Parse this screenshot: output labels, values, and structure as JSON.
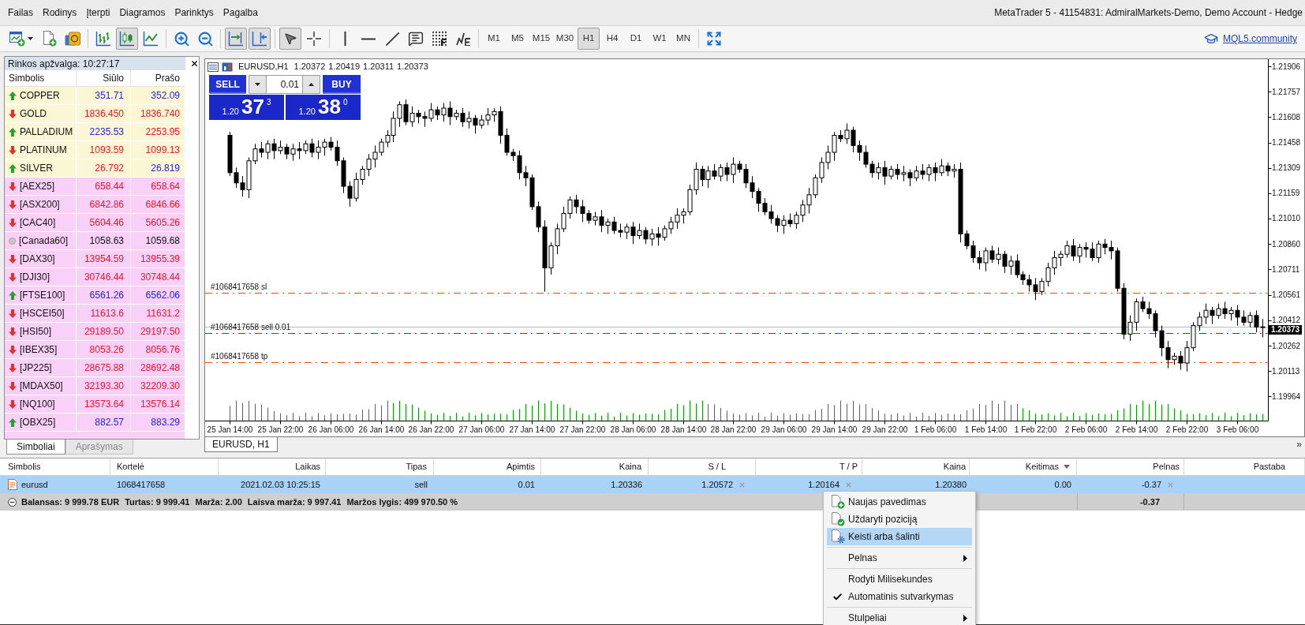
{
  "window": {
    "title": "MetaTrader 5 - 41154831: AdmiralMarkets-Demo, Demo Account - Hedge"
  },
  "menu": [
    "Failas",
    "Rodinys",
    "Įterpti",
    "Diagramos",
    "Parinktys",
    "Pagalba"
  ],
  "toolbar": {
    "tool_groups": [
      [
        {
          "pressed": false
        },
        {
          "pressed": false
        },
        {
          "pressed": false
        }
      ],
      [
        {
          "pressed": false
        },
        {
          "pressed": true
        },
        {
          "pressed": false
        }
      ],
      [
        {
          "pressed": false
        },
        {
          "pressed": false
        }
      ],
      [
        {
          "pressed": true
        },
        {
          "pressed": true
        }
      ],
      [
        {
          "pressed": true
        },
        {
          "pressed": false
        }
      ],
      [
        {
          "pressed": false
        },
        {
          "pressed": false
        },
        {
          "pressed": false
        },
        {
          "pressed": false
        },
        {
          "pressed": false
        },
        {
          "pressed": false
        }
      ]
    ],
    "timeframes": [
      {
        "label": "M1",
        "selected": false
      },
      {
        "label": "M5",
        "selected": false
      },
      {
        "label": "M15",
        "selected": false
      },
      {
        "label": "M30",
        "selected": false
      },
      {
        "label": "H1",
        "selected": true
      },
      {
        "label": "H4",
        "selected": false
      },
      {
        "label": "D1",
        "selected": false
      },
      {
        "label": "W1",
        "selected": false
      },
      {
        "label": "MN",
        "selected": false
      }
    ],
    "view_tools": [
      {
        "pressed": false
      }
    ],
    "community_link": "MQL5.community"
  },
  "market_watch": {
    "title": "Rinkos apžvalga: 10:27:17",
    "columns": [
      "Simbolis",
      "Siūlo",
      "Prašo"
    ],
    "rows": [
      {
        "symbol": "COPPER",
        "kind": "up",
        "bid": {
          "text": "351.71",
          "color": "#1f1fe0"
        },
        "ask": {
          "text": "352.09",
          "color": "#1f1fe0"
        },
        "color": "#fbf6d3"
      },
      {
        "symbol": "GOLD",
        "kind": "down",
        "bid": {
          "text": "1836.450",
          "color": "#f0142a"
        },
        "ask": {
          "text": "1836.740",
          "color": "#f0142a"
        },
        "color": "#fbf6d3"
      },
      {
        "symbol": "PALLADIUM",
        "kind": "up",
        "bid": {
          "text": "2235.53",
          "color": "#1f1fe0"
        },
        "ask": {
          "text": "2253.95",
          "color": "#f0142a"
        },
        "color": "#fbf6d3"
      },
      {
        "symbol": "PLATINUM",
        "kind": "down",
        "bid": {
          "text": "1093.59",
          "color": "#f0142a"
        },
        "ask": {
          "text": "1099.13",
          "color": "#f0142a"
        },
        "color": "#fbf6d3"
      },
      {
        "symbol": "SILVER",
        "kind": "up",
        "bid": {
          "text": "26.792",
          "color": "#f0142a"
        },
        "ask": {
          "text": "26.819",
          "color": "#1f1fe0"
        },
        "color": "#fbf6d3"
      },
      {
        "symbol": "[AEX25]",
        "kind": "down",
        "bid": {
          "text": "658.44",
          "color": "#f0142a"
        },
        "ask": {
          "text": "658.64",
          "color": "#f0142a"
        },
        "color": "#f8d0f8"
      },
      {
        "symbol": "[ASX200]",
        "kind": "down",
        "bid": {
          "text": "6842.86",
          "color": "#f0142a"
        },
        "ask": {
          "text": "6846.66",
          "color": "#f0142a"
        },
        "color": "#f8d0f8"
      },
      {
        "symbol": "[CAC40]",
        "kind": "down",
        "bid": {
          "text": "5604.46",
          "color": "#f0142a"
        },
        "ask": {
          "text": "5605.26",
          "color": "#f0142a"
        },
        "color": "#f8d0f8"
      },
      {
        "symbol": "[Canada60]",
        "kind": "flat",
        "bid": {
          "text": "1058.63",
          "color": "#111111"
        },
        "ask": {
          "text": "1059.68",
          "color": "#111111"
        },
        "color": "#f8d0f8"
      },
      {
        "symbol": "[DAX30]",
        "kind": "down",
        "bid": {
          "text": "13954.59",
          "color": "#f0142a"
        },
        "ask": {
          "text": "13955.39",
          "color": "#f0142a"
        },
        "color": "#f8d0f8"
      },
      {
        "symbol": "[DJI30]",
        "kind": "down",
        "bid": {
          "text": "30746.44",
          "color": "#f0142a"
        },
        "ask": {
          "text": "30748.44",
          "color": "#f0142a"
        },
        "color": "#f8d0f8"
      },
      {
        "symbol": "[FTSE100]",
        "kind": "up",
        "bid": {
          "text": "6561.26",
          "color": "#1f1fe0"
        },
        "ask": {
          "text": "6562.06",
          "color": "#1f1fe0"
        },
        "color": "#f8d0f8"
      },
      {
        "symbol": "[HSCEI50]",
        "kind": "down",
        "bid": {
          "text": "11613.6",
          "color": "#f0142a"
        },
        "ask": {
          "text": "11631.2",
          "color": "#f0142a"
        },
        "color": "#f8d0f8"
      },
      {
        "symbol": "[HSI50]",
        "kind": "down",
        "bid": {
          "text": "29189.50",
          "color": "#f0142a"
        },
        "ask": {
          "text": "29197.50",
          "color": "#f0142a"
        },
        "color": "#f8d0f8"
      },
      {
        "symbol": "[IBEX35]",
        "kind": "down",
        "bid": {
          "text": "8053.26",
          "color": "#f0142a"
        },
        "ask": {
          "text": "8056.76",
          "color": "#f0142a"
        },
        "color": "#f8d0f8"
      },
      {
        "symbol": "[JP225]",
        "kind": "down",
        "bid": {
          "text": "28675.88",
          "color": "#f0142a"
        },
        "ask": {
          "text": "28692.48",
          "color": "#f0142a"
        },
        "color": "#f8d0f8"
      },
      {
        "symbol": "[MDAX50]",
        "kind": "down",
        "bid": {
          "text": "32193.30",
          "color": "#f0142a"
        },
        "ask": {
          "text": "32209.30",
          "color": "#f0142a"
        },
        "color": "#f8d0f8"
      },
      {
        "symbol": "[NQ100]",
        "kind": "down",
        "bid": {
          "text": "13573.64",
          "color": "#f0142a"
        },
        "ask": {
          "text": "13576.14",
          "color": "#f0142a"
        },
        "color": "#f8d0f8"
      },
      {
        "symbol": "[OBX25]",
        "kind": "up",
        "bid": {
          "text": "882.57",
          "color": "#1f1fe0"
        },
        "ask": {
          "text": "883.29",
          "color": "#1f1fe0"
        },
        "color": "#f8d0f8"
      }
    ],
    "tabs": [
      {
        "label": "Simboliai",
        "selected": true
      },
      {
        "label": "Aprašymas",
        "selected": false
      }
    ]
  },
  "chart": {
    "symbol": "EURUSD,H1",
    "ohlc": [
      "1.20372",
      "1.20419",
      "1.20311",
      "1.20373"
    ],
    "trade_panel": {
      "sell": "SELL",
      "buy": "BUY",
      "volume": "0.01",
      "sell_price": {
        "big_figure": "1.20",
        "pips": "37",
        "fraction": "3"
      },
      "buy_price": {
        "big_figure": "1.20",
        "pips": "38",
        "fraction": "0"
      }
    },
    "current_price": "1.20373",
    "chart_data": {
      "type": "candlestick",
      "ylim": [
        1.19821,
        1.21948
      ],
      "ref_lines": [
        {
          "axis": "y",
          "value": 1.20572,
          "label": "#1068417658 sl",
          "color": "#ff4500"
        },
        {
          "axis": "y",
          "value": 1.20373,
          "color": "#b8b8b8"
        },
        {
          "axis": "y",
          "value": 1.20336,
          "label": "#1068417658 sell 0.01",
          "color": "#008000"
        },
        {
          "axis": "y",
          "value": 1.20164,
          "label": "#1068417658 tp",
          "color": "#ff4500"
        }
      ],
      "yticks": [
        {
          "value": 1.21906,
          "label": "1.21906"
        },
        {
          "value": 1.21757,
          "label": "1.21757"
        },
        {
          "value": 1.21608,
          "label": "1.21608"
        },
        {
          "value": 1.21458,
          "label": "1.21458"
        },
        {
          "value": 1.21309,
          "label": "1.21309"
        },
        {
          "value": 1.21159,
          "label": "1.21159"
        },
        {
          "value": 1.2101,
          "label": "1.21010"
        },
        {
          "value": 1.2086,
          "label": "1.20860"
        },
        {
          "value": 1.20711,
          "label": "1.20711"
        },
        {
          "value": 1.20561,
          "label": "1.20561"
        },
        {
          "value": 1.20412,
          "label": "1.20412"
        },
        {
          "value": 1.20262,
          "label": "1.20262"
        },
        {
          "value": 1.20113,
          "label": "1.20113"
        },
        {
          "value": 1.19964,
          "label": "1.19964"
        }
      ],
      "categories": [
        "25 Jan 14:00",
        null,
        null,
        null,
        null,
        null,
        null,
        null,
        "25 Jan 22:00",
        null,
        null,
        null,
        null,
        null,
        null,
        null,
        "26 Jan 06:00",
        null,
        null,
        null,
        null,
        null,
        null,
        null,
        "26 Jan 14:00",
        null,
        null,
        null,
        null,
        null,
        null,
        null,
        "26 Jan 22:00",
        null,
        null,
        null,
        null,
        null,
        null,
        null,
        "27 Jan 06:00",
        null,
        null,
        null,
        null,
        null,
        null,
        null,
        "27 Jan 14:00",
        null,
        null,
        null,
        null,
        null,
        null,
        null,
        "27 Jan 22:00",
        null,
        null,
        null,
        null,
        null,
        null,
        null,
        "28 Jan 06:00",
        null,
        null,
        null,
        null,
        null,
        null,
        null,
        "28 Jan 14:00",
        null,
        null,
        null,
        null,
        null,
        null,
        null,
        "28 Jan 22:00",
        null,
        null,
        null,
        null,
        null,
        null,
        null,
        "29 Jan 06:00",
        null,
        null,
        null,
        null,
        null,
        null,
        null,
        "29 Jan 14:00",
        null,
        null,
        null,
        null,
        null,
        null,
        null,
        "29 Jan 22:00",
        null,
        null,
        null,
        null,
        null,
        null,
        null,
        "1 Feb 06:00",
        null,
        null,
        null,
        null,
        null,
        null,
        null,
        "1 Feb 14:00",
        null,
        null,
        null,
        null,
        null,
        null,
        null,
        "1 Feb 22:00",
        null,
        null,
        null,
        null,
        null,
        null,
        null,
        "2 Feb 06:00",
        null,
        null,
        null,
        null,
        null,
        null,
        null,
        "2 Feb 14:00",
        null,
        null,
        null,
        null,
        null,
        null,
        null,
        "2 Feb 22:00",
        null,
        null,
        null,
        null,
        null,
        null,
        null,
        "3 Feb 06:00",
        null,
        null,
        null,
        null
      ],
      "ohlc": [
        [
          1.215,
          1.2152,
          1.2126,
          1.2128
        ],
        [
          1.2128,
          1.2131,
          1.2119,
          1.2122
        ],
        [
          1.2122,
          1.2126,
          1.2114,
          1.2118
        ],
        [
          1.2118,
          1.2137,
          1.2113,
          1.2135
        ],
        [
          1.2135,
          1.2145,
          1.2133,
          1.2142
        ],
        [
          1.2142,
          1.2146,
          1.2137,
          1.214
        ],
        [
          1.214,
          1.2147,
          1.2136,
          1.2145
        ],
        [
          1.2145,
          1.2148,
          1.2136,
          1.2141
        ],
        [
          1.2141,
          1.2147,
          1.2139,
          1.2143
        ],
        [
          1.2143,
          1.2145,
          1.2136,
          1.2139
        ],
        [
          1.2139,
          1.2145,
          1.2135,
          1.2142
        ],
        [
          1.2142,
          1.2146,
          1.2136,
          1.2141
        ],
        [
          1.2141,
          1.2147,
          1.2139,
          1.2145
        ],
        [
          1.2145,
          1.2148,
          1.2137,
          1.214
        ],
        [
          1.214,
          1.2147,
          1.2136,
          1.2143
        ],
        [
          1.2143,
          1.2148,
          1.2138,
          1.2146
        ],
        [
          1.2146,
          1.2149,
          1.2141,
          1.2143
        ],
        [
          1.2143,
          1.2147,
          1.2132,
          1.2135
        ],
        [
          1.2135,
          1.2137,
          1.2116,
          1.212
        ],
        [
          1.212,
          1.2123,
          1.2108,
          1.2113
        ],
        [
          1.2113,
          1.2128,
          1.2111,
          1.2124
        ],
        [
          1.2124,
          1.2132,
          1.2121,
          1.213
        ],
        [
          1.213,
          1.2139,
          1.2126,
          1.2136
        ],
        [
          1.2136,
          1.2144,
          1.2131,
          1.214
        ],
        [
          1.214,
          1.2148,
          1.2138,
          1.2146
        ],
        [
          1.2146,
          1.2153,
          1.2143,
          1.215
        ],
        [
          1.215,
          1.2164,
          1.2146,
          1.216
        ],
        [
          1.216,
          1.217,
          1.2155,
          1.2168
        ],
        [
          1.2168,
          1.2171,
          1.2156,
          1.2158
        ],
        [
          1.2158,
          1.2167,
          1.2155,
          1.2163
        ],
        [
          1.2163,
          1.2165,
          1.2157,
          1.2161
        ],
        [
          1.2161,
          1.2164,
          1.2155,
          1.216
        ],
        [
          1.216,
          1.2169,
          1.2158,
          1.2165
        ],
        [
          1.2165,
          1.2167,
          1.2159,
          1.2162
        ],
        [
          1.2162,
          1.2169,
          1.2158,
          1.2166
        ],
        [
          1.2166,
          1.217,
          1.2156,
          1.2161
        ],
        [
          1.2161,
          1.2165,
          1.2159,
          1.2163
        ],
        [
          1.2163,
          1.2166,
          1.2155,
          1.2158
        ],
        [
          1.2158,
          1.2164,
          1.2154,
          1.216
        ],
        [
          1.216,
          1.2162,
          1.2151,
          1.2156
        ],
        [
          1.2156,
          1.2162,
          1.2154,
          1.2159
        ],
        [
          1.2159,
          1.2166,
          1.2156,
          1.2162
        ],
        [
          1.2162,
          1.2166,
          1.2158,
          1.2164
        ],
        [
          1.2164,
          1.2167,
          1.2145,
          1.215
        ],
        [
          1.215,
          1.2154,
          1.2138,
          1.214
        ],
        [
          1.214,
          1.2142,
          1.2135,
          1.2138
        ],
        [
          1.2138,
          1.2141,
          1.2124,
          1.2128
        ],
        [
          1.2128,
          1.2132,
          1.212,
          1.2125
        ],
        [
          1.2125,
          1.2127,
          1.2106,
          1.2108
        ],
        [
          1.2108,
          1.2111,
          1.2093,
          1.2096
        ],
        [
          1.2096,
          1.21,
          1.2058,
          1.2072
        ],
        [
          1.2072,
          1.2087,
          1.2068,
          1.2085
        ],
        [
          1.2085,
          1.2098,
          1.208,
          1.2095
        ],
        [
          1.2095,
          1.2108,
          1.2093,
          1.2104
        ],
        [
          1.2104,
          1.2114,
          1.2101,
          1.2112
        ],
        [
          1.2112,
          1.2115,
          1.2104,
          1.2108
        ],
        [
          1.2108,
          1.2112,
          1.2099,
          1.2104
        ],
        [
          1.2104,
          1.2106,
          1.2098,
          1.21
        ],
        [
          1.21,
          1.2105,
          1.2097,
          1.2102
        ],
        [
          1.2102,
          1.2106,
          1.2093,
          1.2097
        ],
        [
          1.2097,
          1.2101,
          1.2092,
          1.2099
        ],
        [
          1.2099,
          1.2102,
          1.2092,
          1.2094
        ],
        [
          1.2094,
          1.2098,
          1.209,
          1.2093
        ],
        [
          1.2093,
          1.2098,
          1.2089,
          1.2096
        ],
        [
          1.2096,
          1.2099,
          1.2086,
          1.2091
        ],
        [
          1.2091,
          1.2098,
          1.2089,
          1.2094
        ],
        [
          1.2094,
          1.2096,
          1.2086,
          1.2089
        ],
        [
          1.2089,
          1.2095,
          1.2085,
          1.2092
        ],
        [
          1.2092,
          1.2096,
          1.2085,
          1.209
        ],
        [
          1.209,
          1.2097,
          1.2088,
          1.2095
        ],
        [
          1.2095,
          1.2102,
          1.2092,
          1.2099
        ],
        [
          1.2099,
          1.2107,
          1.2095,
          1.2103
        ],
        [
          1.2103,
          1.2107,
          1.2098,
          1.2105
        ],
        [
          1.2105,
          1.2121,
          1.2103,
          1.2118
        ],
        [
          1.2118,
          1.2134,
          1.2115,
          1.213
        ],
        [
          1.213,
          1.2132,
          1.212,
          1.2124
        ],
        [
          1.2124,
          1.2132,
          1.2119,
          1.2129
        ],
        [
          1.2129,
          1.2133,
          1.2124,
          1.2126
        ],
        [
          1.2126,
          1.2133,
          1.2123,
          1.2131
        ],
        [
          1.2131,
          1.2134,
          1.2123,
          1.2127
        ],
        [
          1.2127,
          1.2137,
          1.2122,
          1.2133
        ],
        [
          1.2133,
          1.2135,
          1.2128,
          1.213
        ],
        [
          1.213,
          1.2133,
          1.2119,
          1.2122
        ],
        [
          1.2122,
          1.2126,
          1.2113,
          1.2117
        ],
        [
          1.2117,
          1.2119,
          1.2105,
          1.211
        ],
        [
          1.211,
          1.2113,
          1.2103,
          1.2105
        ],
        [
          1.2105,
          1.2109,
          1.2098,
          1.2101
        ],
        [
          1.2101,
          1.2103,
          1.2093,
          1.2097
        ],
        [
          1.2097,
          1.2103,
          1.2092,
          1.21
        ],
        [
          1.21,
          1.2104,
          1.2096,
          1.2098
        ],
        [
          1.2098,
          1.2105,
          1.2095,
          1.2103
        ],
        [
          1.2103,
          1.2112,
          1.2099,
          1.2109
        ],
        [
          1.2109,
          1.2119,
          1.2104,
          1.2115
        ],
        [
          1.2115,
          1.2127,
          1.2113,
          1.2125
        ],
        [
          1.2125,
          1.2137,
          1.2122,
          1.2134
        ],
        [
          1.2134,
          1.2144,
          1.213,
          1.214
        ],
        [
          1.214,
          1.2152,
          1.2135,
          1.215
        ],
        [
          1.215,
          1.2153,
          1.2146,
          1.2148
        ],
        [
          1.2148,
          1.2157,
          1.2145,
          1.2153
        ],
        [
          1.2153,
          1.2155,
          1.214,
          1.2144
        ],
        [
          1.2144,
          1.2147,
          1.2135,
          1.214
        ],
        [
          1.214,
          1.2144,
          1.2131,
          1.2133
        ],
        [
          1.2133,
          1.2135,
          1.2125,
          1.2128
        ],
        [
          1.2128,
          1.2134,
          1.2124,
          1.2131
        ],
        [
          1.2131,
          1.2135,
          1.2121,
          1.2126
        ],
        [
          1.2126,
          1.2132,
          1.2124,
          1.213
        ],
        [
          1.213,
          1.2133,
          1.2124,
          1.2127
        ],
        [
          1.2127,
          1.2132,
          1.2123,
          1.2128
        ],
        [
          1.2128,
          1.213,
          1.212,
          1.2125
        ],
        [
          1.2125,
          1.2132,
          1.2123,
          1.2129
        ],
        [
          1.2129,
          1.2133,
          1.2124,
          1.2127
        ],
        [
          1.2127,
          1.2133,
          1.2123,
          1.2131
        ],
        [
          1.2131,
          1.2134,
          1.2123,
          1.2128
        ],
        [
          1.2128,
          1.2136,
          1.2126,
          1.2132
        ],
        [
          1.2132,
          1.2134,
          1.2126,
          1.2129
        ],
        [
          1.2129,
          1.2133,
          1.2125,
          1.213
        ],
        [
          1.213,
          1.2134,
          1.2087,
          1.2092
        ],
        [
          1.2092,
          1.2094,
          1.2083,
          1.2085
        ],
        [
          1.2085,
          1.2088,
          1.2075,
          1.2078
        ],
        [
          1.2078,
          1.2082,
          1.2071,
          1.2075
        ],
        [
          1.2075,
          1.2084,
          1.207,
          1.2082
        ],
        [
          1.2082,
          1.2085,
          1.2075,
          1.2077
        ],
        [
          1.2077,
          1.2084,
          1.2074,
          1.208
        ],
        [
          1.208,
          1.2082,
          1.2069,
          1.2073
        ],
        [
          1.2073,
          1.2079,
          1.2068,
          1.2076
        ],
        [
          1.2076,
          1.208,
          1.2066,
          1.2068
        ],
        [
          1.2068,
          1.207,
          1.2062,
          1.2065
        ],
        [
          1.2065,
          1.2068,
          1.2058,
          1.2062
        ],
        [
          1.2062,
          1.2066,
          1.2053,
          1.2058
        ],
        [
          1.2058,
          1.2066,
          1.2056,
          1.2064
        ],
        [
          1.2064,
          1.2075,
          1.2061,
          1.2072
        ],
        [
          1.2072,
          1.2082,
          1.2068,
          1.2078
        ],
        [
          1.2078,
          1.2082,
          1.2073,
          1.208
        ],
        [
          1.208,
          1.2088,
          1.2078,
          1.2085
        ],
        [
          1.2085,
          1.2089,
          1.2076,
          1.2079
        ],
        [
          1.2079,
          1.2086,
          1.2075,
          1.2084
        ],
        [
          1.2084,
          1.2087,
          1.2078,
          1.2083
        ],
        [
          1.2083,
          1.2087,
          1.2076,
          1.2078
        ],
        [
          1.2078,
          1.2088,
          1.2075,
          1.2086
        ],
        [
          1.2086,
          1.2089,
          1.208,
          1.2084
        ],
        [
          1.2084,
          1.2088,
          1.2077,
          1.2082
        ],
        [
          1.2082,
          1.2084,
          1.2058,
          1.206
        ],
        [
          1.206,
          1.2063,
          1.203,
          1.2033
        ],
        [
          1.2033,
          1.2044,
          1.2029,
          1.204
        ],
        [
          1.204,
          1.2054,
          1.2035,
          1.2052
        ],
        [
          1.2052,
          1.2055,
          1.2046,
          1.2048
        ],
        [
          1.2048,
          1.2052,
          1.2042,
          1.2045
        ],
        [
          1.2045,
          1.2047,
          1.2031,
          1.2035
        ],
        [
          1.2035,
          1.2038,
          1.202,
          1.2025
        ],
        [
          1.2025,
          1.2029,
          1.2013,
          1.2018
        ],
        [
          1.2018,
          1.2022,
          1.2015,
          1.202
        ],
        [
          1.202,
          1.2023,
          1.2012,
          1.2016
        ],
        [
          1.2016,
          1.2029,
          1.2011,
          1.2025
        ],
        [
          1.2025,
          1.204,
          1.2023,
          1.2038
        ],
        [
          1.2038,
          1.2046,
          1.2035,
          1.2043
        ],
        [
          1.2043,
          1.2051,
          1.2039,
          1.2047
        ],
        [
          1.2047,
          1.2049,
          1.2039,
          1.2044
        ],
        [
          1.2044,
          1.2051,
          1.2042,
          1.2048
        ],
        [
          1.2048,
          1.2052,
          1.2042,
          1.2045
        ],
        [
          1.2045,
          1.2049,
          1.2041,
          1.2047
        ],
        [
          1.2047,
          1.205,
          1.2038,
          1.2043
        ],
        [
          1.2043,
          1.2047,
          1.2038,
          1.204
        ],
        [
          1.204,
          1.2046,
          1.2037,
          1.2044
        ],
        [
          1.2044,
          1.2047,
          1.2034,
          1.20372
        ],
        [
          1.20372,
          1.20419,
          1.20311,
          1.20373
        ]
      ]
    },
    "tabs": [
      {
        "label": "EURUSD, H1",
        "selected": true
      }
    ],
    "more_button": "»"
  },
  "terminal": {
    "columns": [
      {
        "label": "Simbolis",
        "sorted": false
      },
      {
        "label": "Kortelė",
        "sorted": false
      },
      {
        "label": "Laikas",
        "sorted": false
      },
      {
        "label": "Tipas",
        "sorted": false
      },
      {
        "label": "Apimtis",
        "sorted": false
      },
      {
        "label": "Kaina",
        "sorted": false
      },
      {
        "label": "S / L",
        "sorted": false
      },
      {
        "label": "T / P",
        "sorted": false
      },
      {
        "label": "Kaina",
        "sorted": false
      },
      {
        "label": "Keitimas",
        "sorted": true
      },
      {
        "label": "Pelnas",
        "sorted": false
      },
      {
        "label": "Pastaba",
        "sorted": false
      }
    ],
    "rows": [
      {
        "cells": [
          "eurusd",
          "1068417658",
          "2021.02.03 10:25:15",
          "sell",
          "0.01",
          "1.20336",
          "1.20572",
          "1.20164",
          "1.20380",
          "0.00",
          "-0.37"
        ],
        "selected": true
      }
    ],
    "summary": {
      "expanded": true,
      "items": [
        "Balansas: 9 999.78 EUR",
        "Turtas: 9 999.41",
        "Marža: 2.00",
        "Laisva marža: 9 997.41",
        "Maržos lygis: 499 970.50 %"
      ],
      "profit": "-0.37"
    }
  },
  "context_menu": {
    "groups": [
      [
        {
          "label": "Naujas pavedimas",
          "selected": false,
          "checked": false,
          "submenu": false
        },
        {
          "label": "Uždaryti poziciją",
          "selected": false,
          "checked": false,
          "submenu": false
        },
        {
          "label": "Keisti arba šalinti",
          "selected": true,
          "checked": false,
          "submenu": false
        }
      ],
      [
        {
          "label": "Pelnas",
          "selected": false,
          "checked": false,
          "submenu": true
        }
      ],
      [
        {
          "label": "Rodyti Milisekundes",
          "selected": false,
          "checked": false,
          "submenu": false
        },
        {
          "label": "Automatinis sutvarkymas",
          "selected": false,
          "checked": true,
          "submenu": false
        }
      ],
      [
        {
          "label": "Stulpeliai",
          "selected": false,
          "checked": false,
          "submenu": true
        }
      ]
    ]
  }
}
